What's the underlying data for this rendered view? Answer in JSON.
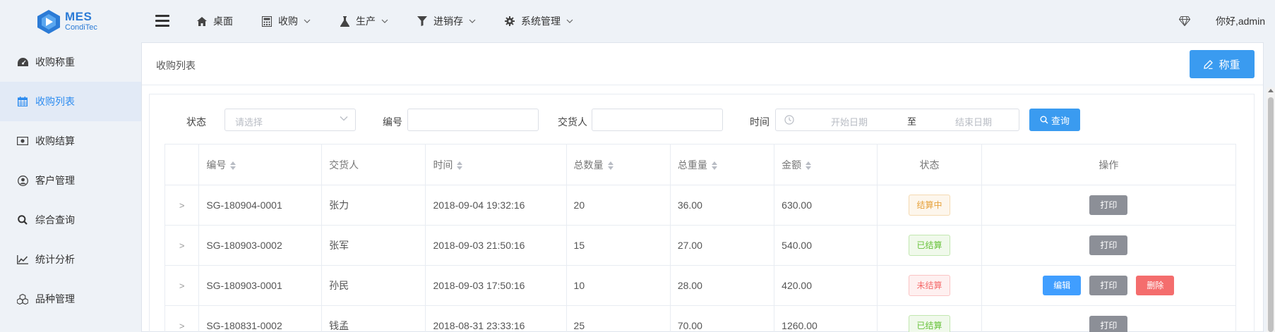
{
  "app": {
    "logo_title": "MES",
    "logo_subtitle": "CondiTec"
  },
  "topnav": [
    {
      "label": "桌面",
      "icon": "home-icon"
    },
    {
      "label": "收购",
      "icon": "calculator-icon"
    },
    {
      "label": "生产",
      "icon": "flask-icon"
    },
    {
      "label": "进销存",
      "icon": "filter-icon"
    },
    {
      "label": "系统管理",
      "icon": "gear-icon"
    }
  ],
  "user": {
    "greeting": "你好,admin"
  },
  "sidebar": {
    "items": [
      {
        "label": "收购称重",
        "icon": "dashboard-icon",
        "active": false
      },
      {
        "label": "收购列表",
        "icon": "calendar-icon",
        "active": true
      },
      {
        "label": "收购结算",
        "icon": "money-icon",
        "active": false
      },
      {
        "label": "客户管理",
        "icon": "user-circle-icon",
        "active": false
      },
      {
        "label": "综合查询",
        "icon": "search-icon",
        "active": false
      },
      {
        "label": "统计分析",
        "icon": "line-chart-icon",
        "active": false
      },
      {
        "label": "品种管理",
        "icon": "cubes-icon",
        "active": false
      }
    ]
  },
  "page": {
    "title": "收购列表",
    "weigh_button": "称重"
  },
  "filters": {
    "status_label": "状态",
    "status_placeholder": "请选择",
    "number_label": "编号",
    "number_value": "",
    "deliverer_label": "交货人",
    "deliverer_value": "",
    "time_label": "时间",
    "start_placeholder": "开始日期",
    "range_separator": "至",
    "end_placeholder": "结束日期",
    "query_button": "查询"
  },
  "table": {
    "headers": {
      "number": "编号",
      "deliverer": "交货人",
      "time": "时间",
      "total_qty": "总数量",
      "total_weight": "总重量",
      "amount": "金额",
      "status": "状态",
      "actions": "操作"
    },
    "action_labels": {
      "edit": "编辑",
      "print": "打印",
      "delete": "删除"
    },
    "rows": [
      {
        "number": "SG-180904-0001",
        "deliverer": "张力",
        "time": "2018-09-04 19:32:16",
        "total_qty": "20",
        "total_weight": "36.00",
        "amount": "630.00",
        "status": "结算中",
        "status_kind": "settling",
        "actions": [
          "print"
        ]
      },
      {
        "number": "SG-180903-0002",
        "deliverer": "张军",
        "time": "2018-09-03 21:50:16",
        "total_qty": "15",
        "total_weight": "27.00",
        "amount": "540.00",
        "status": "已结算",
        "status_kind": "settled",
        "actions": [
          "print"
        ]
      },
      {
        "number": "SG-180903-0001",
        "deliverer": "孙民",
        "time": "2018-09-03 17:50:16",
        "total_qty": "10",
        "total_weight": "28.00",
        "amount": "420.00",
        "status": "未结算",
        "status_kind": "unsettled",
        "actions": [
          "edit",
          "print",
          "delete"
        ]
      },
      {
        "number": "SG-180831-0002",
        "deliverer": "钱孟",
        "time": "2018-08-31 23:33:16",
        "total_qty": "25",
        "total_weight": "70.00",
        "amount": "1260.00",
        "status": "已结算",
        "status_kind": "settled",
        "actions": [
          "print"
        ]
      }
    ]
  },
  "colors": {
    "primary": "#3a9bf0",
    "sidebar_active": "#2d8cf0",
    "print": "#8c8f97",
    "delete": "#f46d6d"
  }
}
